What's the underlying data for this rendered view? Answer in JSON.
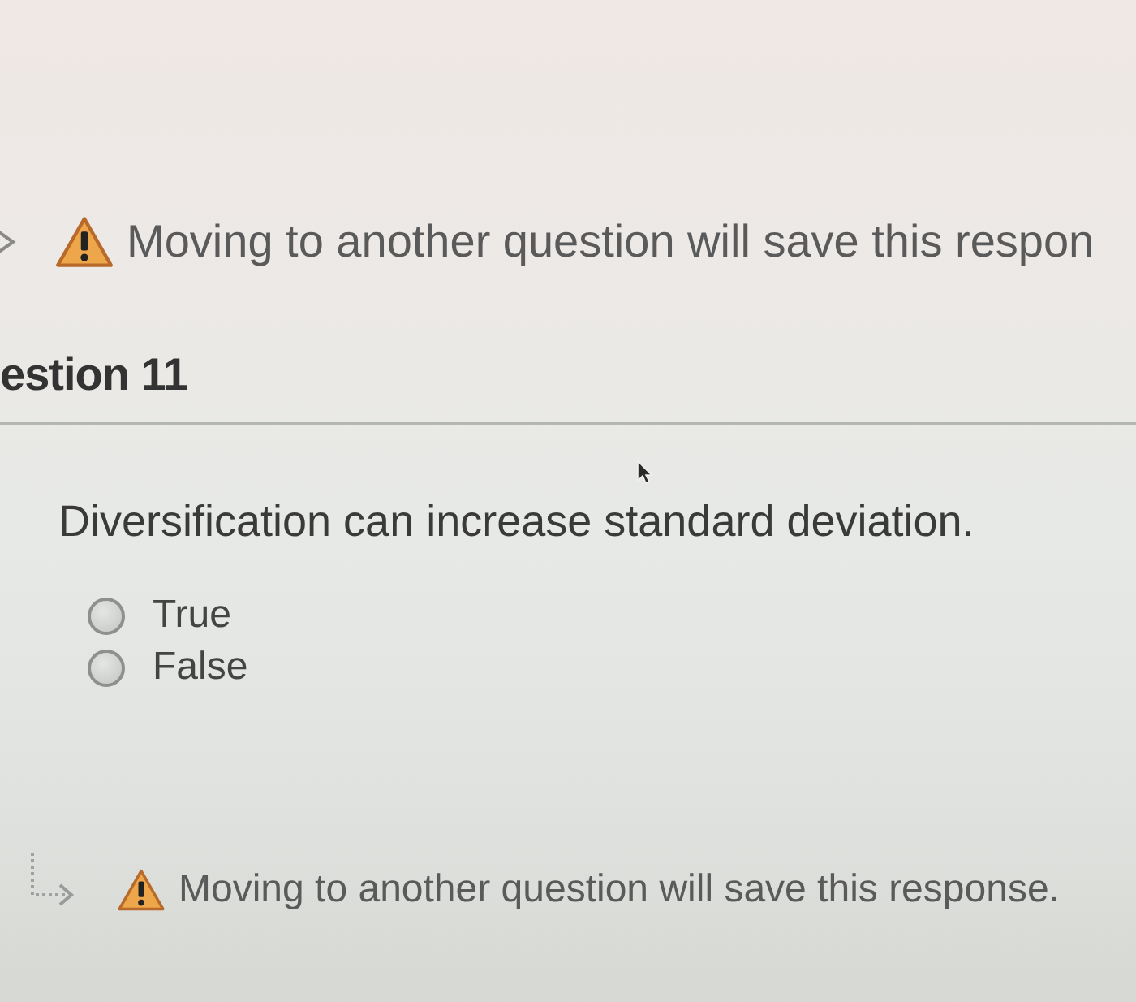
{
  "top_notice": {
    "text": "Moving to another question will save this respon"
  },
  "question": {
    "heading": "estion 11",
    "text": "Diversification can increase standard deviation.",
    "options": [
      {
        "label": "True",
        "selected": false
      },
      {
        "label": "False",
        "selected": false
      }
    ]
  },
  "bottom_notice": {
    "text": "Moving to another question will save this response."
  }
}
